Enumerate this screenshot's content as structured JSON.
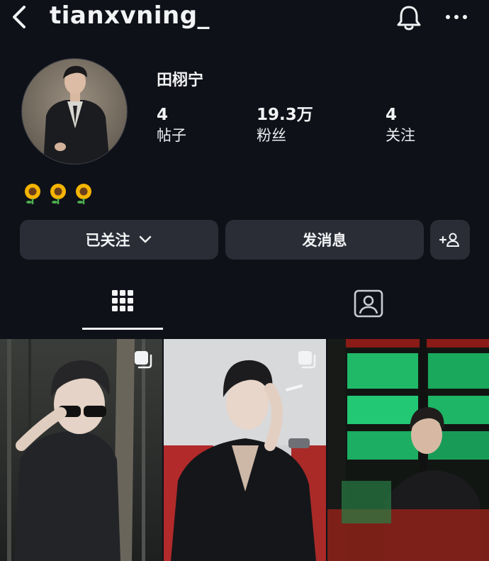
{
  "header": {
    "username": "tianxvning_",
    "back_icon": "chevron-left-icon",
    "notification_icon": "bell-icon",
    "more_icon": "ellipsis-icon"
  },
  "profile": {
    "display_name": "田栩宁",
    "stats": [
      {
        "value": "4",
        "label": "帖子"
      },
      {
        "value": "19.3万",
        "label": "粉丝"
      },
      {
        "value": "4",
        "label": "关注"
      }
    ],
    "bio_icons": [
      "sunflower-icon",
      "sunflower-icon",
      "sunflower-icon"
    ]
  },
  "actions": {
    "following_label": "已关注",
    "message_label": "发消息",
    "add_user_icon": "add-user-icon"
  },
  "tabs": [
    {
      "icon": "grid-icon",
      "selected": true
    },
    {
      "icon": "tagged-person-icon",
      "selected": false
    }
  ],
  "posts": [
    {
      "multi": true
    },
    {
      "multi": true
    },
    {
      "multi": false
    }
  ],
  "colors": {
    "background": "#0f1118",
    "button": "#2a2d36",
    "text": "#f2f3f5"
  }
}
